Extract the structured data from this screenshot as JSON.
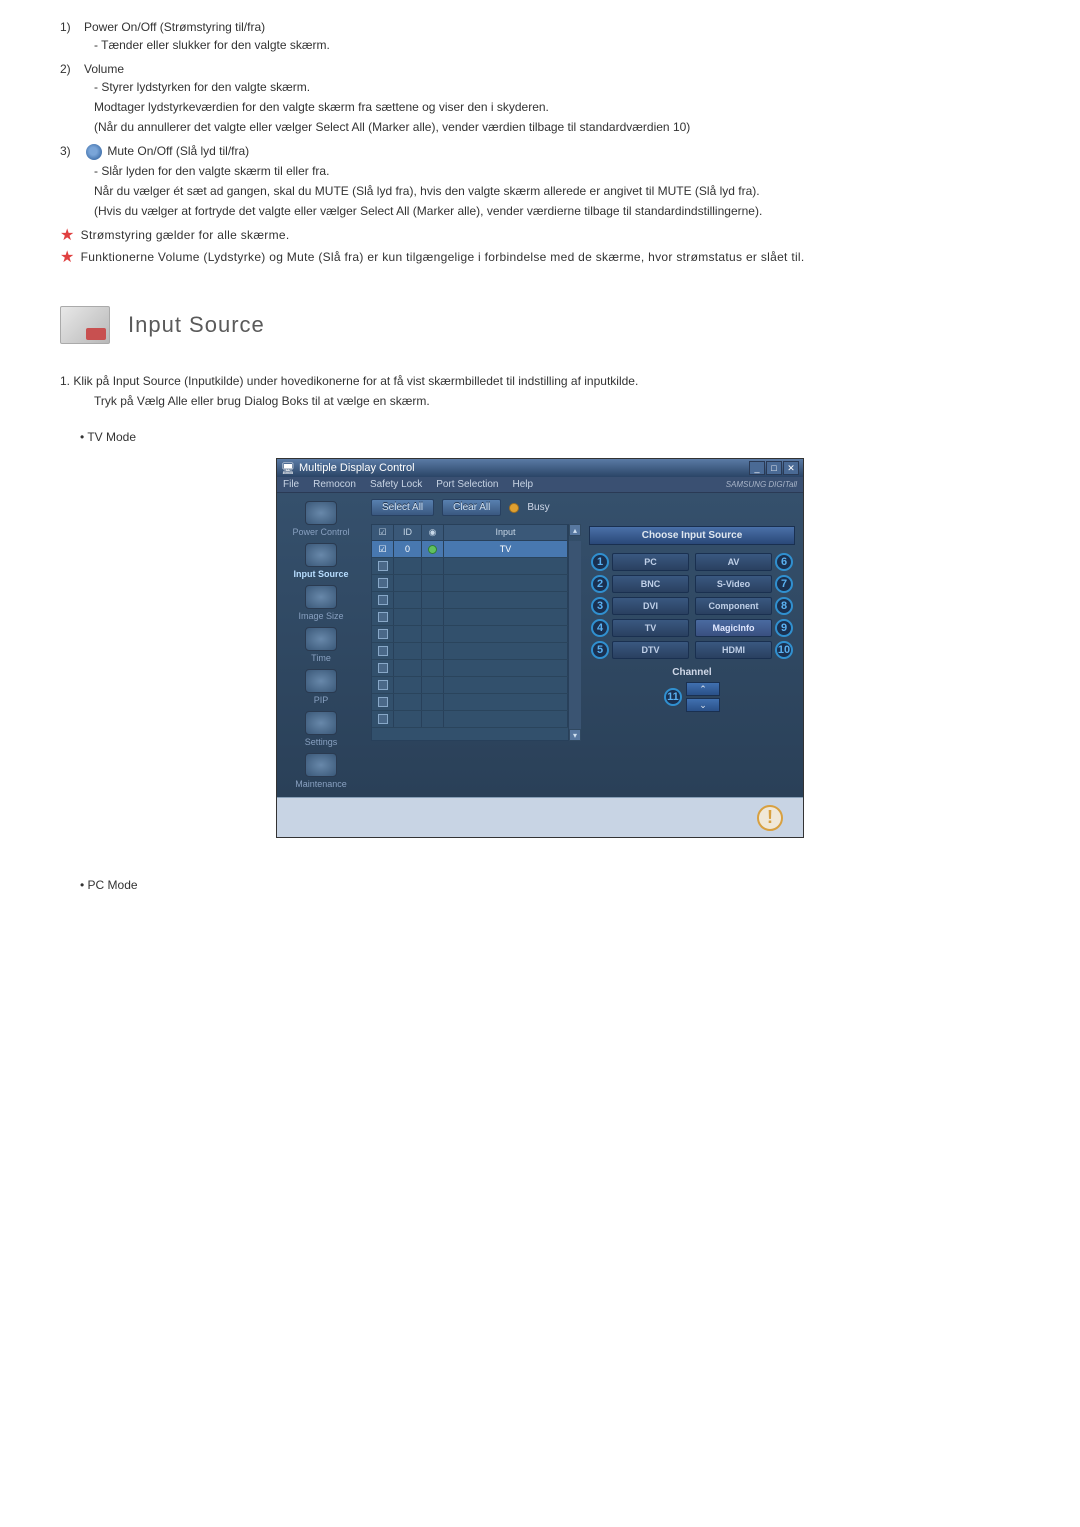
{
  "list1": {
    "marker": "1)",
    "title": "Power On/Off (Strømstyring til/fra)",
    "desc1": "- Tænder eller slukker for den valgte skærm."
  },
  "list2": {
    "marker": "2)",
    "title": "Volume",
    "desc1": "- Styrer lydstyrken for den valgte skærm.",
    "desc2": "Modtager lydstyrkeværdien for den valgte skærm fra sættene og viser den i skyderen.",
    "desc3": "(Når du annullerer det valgte eller vælger Select All (Marker alle), vender værdien tilbage til standardværdien 10)"
  },
  "list3": {
    "marker": "3)",
    "title": "Mute On/Off (Slå lyd til/fra)",
    "desc1": "- Slår lyden for den valgte skærm til eller fra.",
    "desc2": "Når du vælger ét sæt ad gangen, skal du MUTE (Slå lyd fra), hvis den valgte skærm allerede er angivet til MUTE (Slå lyd fra).",
    "desc3": "(Hvis du vælger at fortryde det valgte eller vælger Select All (Marker alle), vender værdierne tilbage til standardindstillingerne)."
  },
  "star1": "Strømstyring gælder for alle skærme.",
  "star2": "Funktionerne Volume (Lydstyrke) og Mute (Slå fra) er kun tilgængelige i forbindelse med de skærme, hvor strømstatus er slået til.",
  "section_title": "Input Source",
  "instr1": "1. Klik på Input Source (Inputkilde) under hovedikonerne for at få vist skærmbilledet til indstilling af inputkilde.",
  "instr1b": "Tryk på Vælg Alle eller brug Dialog Boks til at vælge en skærm.",
  "mode_tv": "TV Mode",
  "mode_pc": "PC Mode",
  "app": {
    "title": "Multiple Display Control",
    "menu": {
      "file": "File",
      "remocon": "Remocon",
      "safety": "Safety Lock",
      "port": "Port Selection",
      "help": "Help"
    },
    "brand": "SAMSUNG DIGITall",
    "sidebar": {
      "power": "Power Control",
      "input": "Input Source",
      "imgsize": "Image Size",
      "time": "Time",
      "pip": "PIP",
      "settings": "Settings",
      "maint": "Maintenance"
    },
    "toolbar": {
      "selectall": "Select All",
      "clearall": "Clear All",
      "busy": "Busy"
    },
    "table": {
      "h_id": "ID",
      "h_input": "Input",
      "r0_id": "0",
      "r0_input": "TV"
    },
    "panel": {
      "header": "Choose Input Source",
      "n1": "1",
      "b1": "PC",
      "n2": "2",
      "b2": "BNC",
      "n3": "3",
      "b3": "DVI",
      "n4": "4",
      "b4": "TV",
      "n5": "5",
      "b5": "DTV",
      "n6": "6",
      "b6": "AV",
      "n7": "7",
      "b7": "S-Video",
      "n8": "8",
      "b8": "Component",
      "n9": "9",
      "b9": "MagicInfo",
      "n10": "10",
      "b10": "HDMI",
      "n11": "11",
      "channel": "Channel"
    }
  }
}
